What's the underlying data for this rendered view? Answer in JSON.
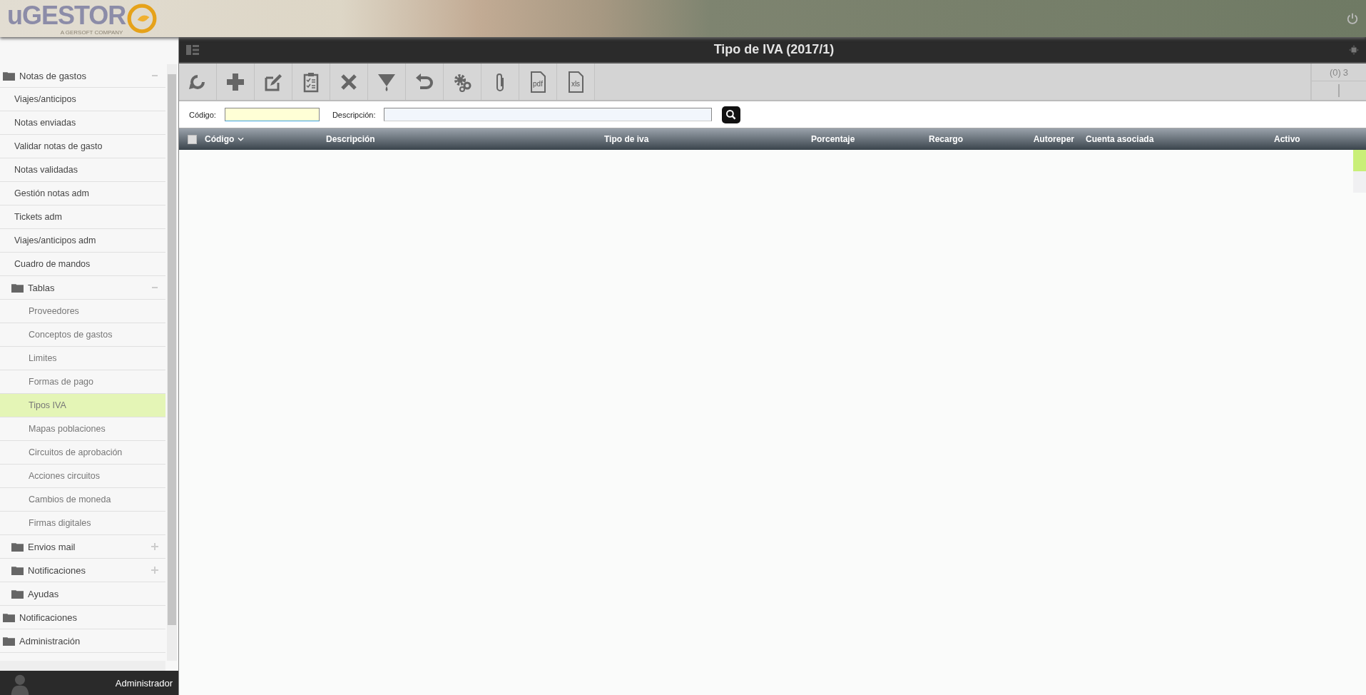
{
  "header": {
    "logo": "uGESTOR",
    "tagline": "A GERSOFT COMPANY"
  },
  "sidebar": {
    "items": [
      {
        "label": "Notas de gastos",
        "kind": "folder",
        "expanded": true,
        "children": [
          {
            "label": "Viajes/anticipos",
            "kind": "link",
            "selected": false
          },
          {
            "label": "Notas enviadas",
            "kind": "link",
            "selected": false
          },
          {
            "label": "Validar notas de gasto",
            "kind": "link",
            "selected": false
          },
          {
            "label": "Notas validadas",
            "kind": "link",
            "selected": false
          },
          {
            "label": "Gestión notas adm",
            "kind": "link",
            "selected": false
          },
          {
            "label": "Tickets adm",
            "kind": "link",
            "selected": false
          },
          {
            "label": "Viajes/anticipos adm",
            "kind": "link",
            "selected": false
          },
          {
            "label": "Cuadro de mandos",
            "kind": "link",
            "selected": false
          },
          {
            "label": "Tablas",
            "kind": "folder",
            "expanded": true,
            "children": [
              {
                "label": "Proveedores",
                "kind": "link",
                "selected": false
              },
              {
                "label": "Conceptos de gastos",
                "kind": "link",
                "selected": false
              },
              {
                "label": "Limites",
                "kind": "link",
                "selected": false
              },
              {
                "label": "Formas de pago",
                "kind": "link",
                "selected": false
              },
              {
                "label": "Tipos IVA",
                "kind": "link",
                "selected": true
              },
              {
                "label": "Mapas poblaciones",
                "kind": "link",
                "selected": false
              },
              {
                "label": "Circuitos de aprobación",
                "kind": "link",
                "selected": false
              },
              {
                "label": "Acciones circuitos",
                "kind": "link",
                "selected": false
              },
              {
                "label": "Cambios de moneda",
                "kind": "link",
                "selected": false
              },
              {
                "label": "Firmas digitales",
                "kind": "link",
                "selected": false
              }
            ]
          },
          {
            "label": "Envios mail",
            "kind": "folder",
            "expanded": false
          },
          {
            "label": "Notificaciones",
            "kind": "folder",
            "expanded": false
          },
          {
            "label": "Ayudas",
            "kind": "folder"
          }
        ]
      },
      {
        "label": "Notificaciones",
        "kind": "folder"
      },
      {
        "label": "Administración",
        "kind": "folder"
      }
    ],
    "user": "Administrador"
  },
  "window": {
    "title": "Tipo de IVA (2017/1)"
  },
  "toolbar": [
    {
      "kind": "refresh"
    },
    {
      "kind": "add"
    },
    {
      "kind": "edit"
    },
    {
      "kind": "checklist"
    },
    {
      "kind": "delete"
    },
    {
      "kind": "filter"
    },
    {
      "kind": "undo"
    },
    {
      "kind": "settings"
    },
    {
      "kind": "attach"
    },
    {
      "kind": "document",
      "label": "pdf"
    },
    {
      "kind": "document",
      "label": "xls"
    }
  ],
  "counter": {
    "selected": "(0)",
    "total": "3"
  },
  "filters": [
    {
      "label": "Código:"
    },
    {
      "label": "Descripción:"
    }
  ],
  "table": {
    "all_selected": false,
    "columns": [
      {
        "label": "Código",
        "sorted": true
      },
      {
        "label": "Descripción",
        "sorted": false
      },
      {
        "label": "Tipo de iva",
        "sorted": false
      },
      {
        "label": "Porcentaje",
        "sorted": false
      },
      {
        "label": "Recargo",
        "sorted": false
      },
      {
        "label": "Autoreper",
        "sorted": false
      },
      {
        "label": "Cuenta asociada",
        "sorted": false
      },
      {
        "label": "Activo",
        "sorted": false
      }
    ]
  }
}
